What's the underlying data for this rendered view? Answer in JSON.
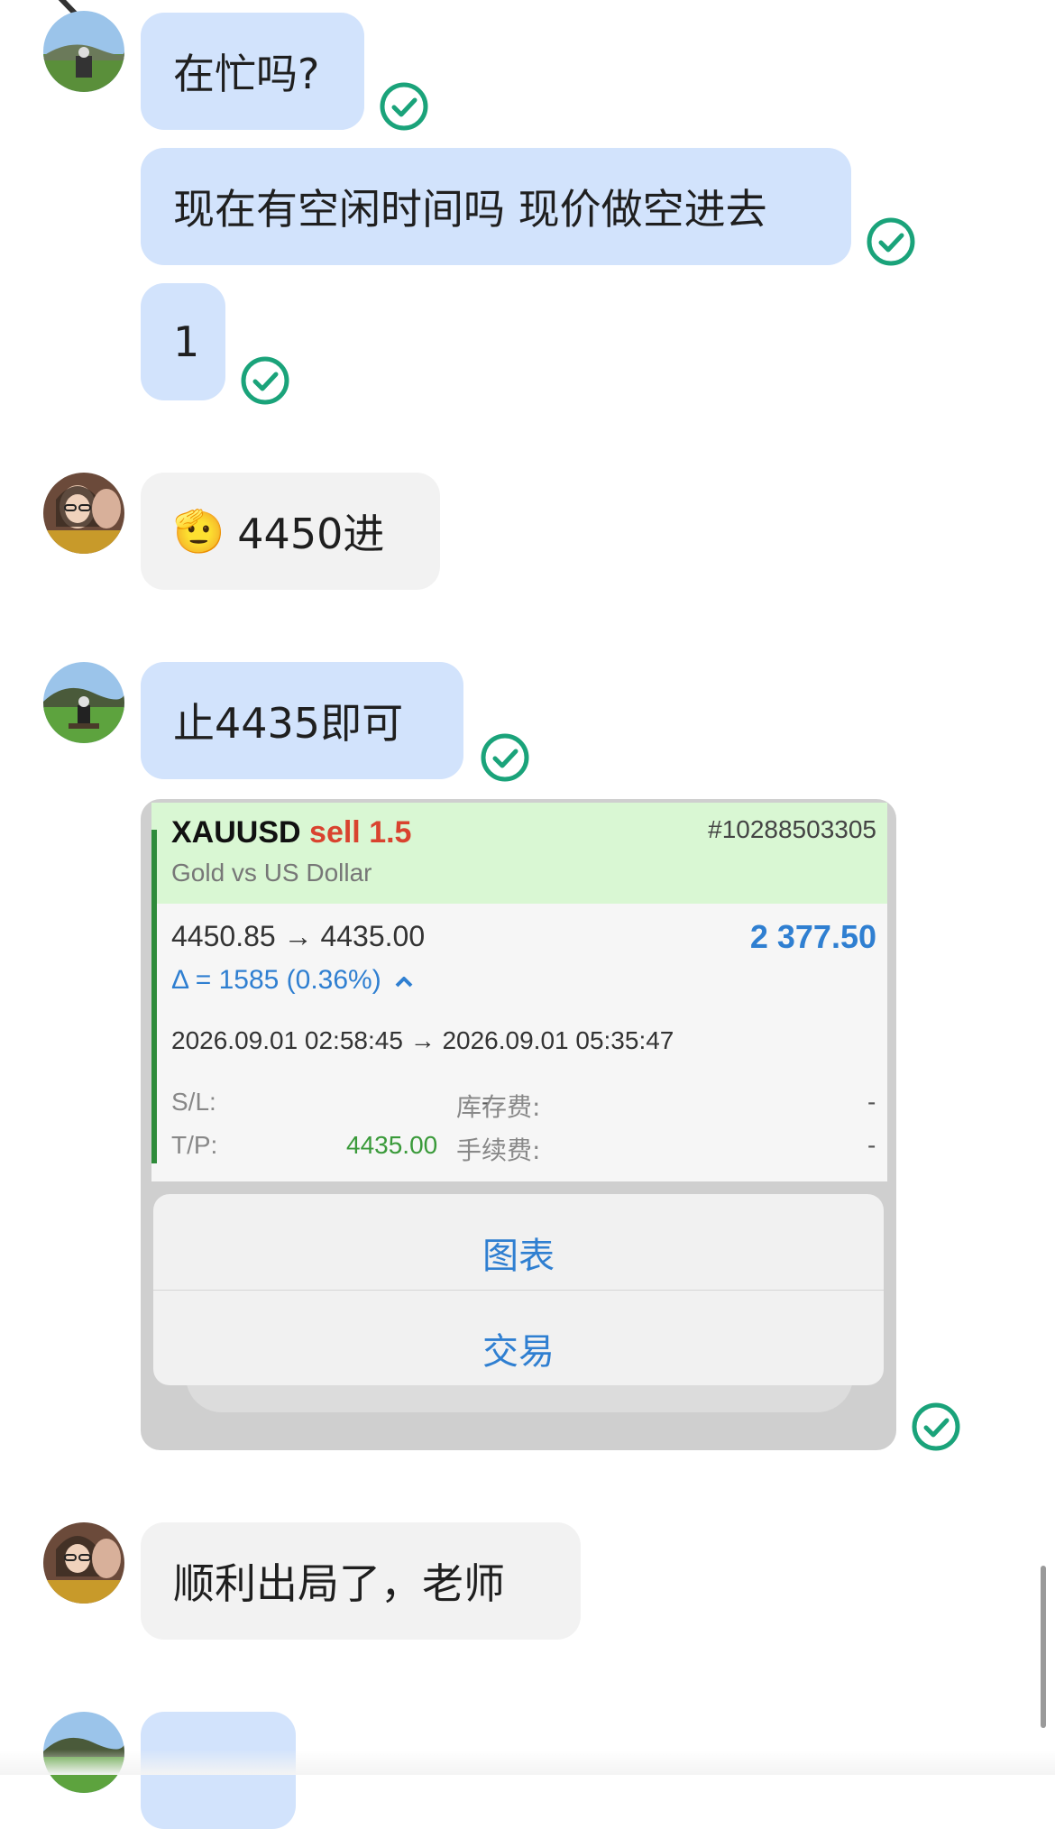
{
  "messages": {
    "m1": "在忙吗?",
    "m2": "现在有空闲时间吗 现价做空进去",
    "m3": "1",
    "m4": "4450进",
    "m5": "止4435即可",
    "m6": "顺利出局了，老师"
  },
  "emoji": {
    "m4": "🫡"
  },
  "trade_card": {
    "symbol": "XAUUSD",
    "side": "sell",
    "volume": "1.5",
    "ticket": "#10288503305",
    "description": "Gold vs US Dollar",
    "price_path": "4450.85 → 4435.00",
    "profit": "2 377.50",
    "delta": "Δ = 1585 (0.36%)",
    "time_path": "2026.09.01 02:58:45 → 2026.09.01 05:35:47",
    "sl_label": "S/L:",
    "sl_value": "-",
    "tp_label": "T/P:",
    "tp_value": "4435.00",
    "swap_label": "库存费:",
    "swap_value": "-",
    "commission_label": "手续费:",
    "commission_value": "-",
    "sheet_chart": "图表",
    "sheet_trade": "交易"
  },
  "colors": {
    "bubble_mine": "#d2e3fc",
    "bubble_theirs": "#f2f2f2",
    "check_color": "#1aa37a",
    "sell_red": "#d9432f",
    "profit_blue": "#2f7fd1",
    "tp_green": "#3a9a3a"
  },
  "icons": {
    "back": "chevron-left-icon",
    "read": "check-circle-icon"
  }
}
